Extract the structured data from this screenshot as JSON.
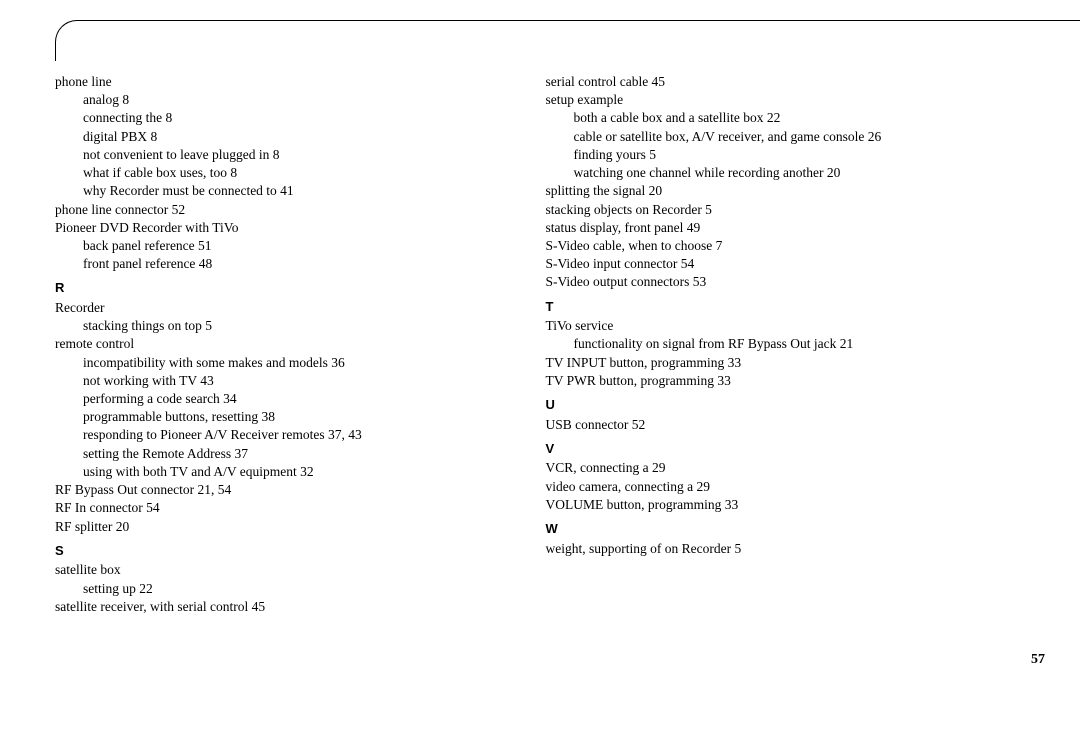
{
  "page_number": "57",
  "left_column": [
    {
      "text": "phone line",
      "indent": 0
    },
    {
      "text": "analog 8",
      "indent": 1
    },
    {
      "text": "connecting the 8",
      "indent": 1
    },
    {
      "text": "digital PBX 8",
      "indent": 1
    },
    {
      "text": "not convenient to leave plugged in 8",
      "indent": 1
    },
    {
      "text": "what if cable box uses, too 8",
      "indent": 1
    },
    {
      "text": "why Recorder must be connected to 41",
      "indent": 1
    },
    {
      "text": "phone line connector 52",
      "indent": 0
    },
    {
      "text": "Pioneer DVD Recorder with TiVo",
      "indent": 0
    },
    {
      "text": "back panel reference 51",
      "indent": 1
    },
    {
      "text": "front panel reference 48",
      "indent": 1
    },
    {
      "letter": "R"
    },
    {
      "text": "Recorder",
      "indent": 0
    },
    {
      "text": "stacking things on top 5",
      "indent": 1
    },
    {
      "text": "remote control",
      "indent": 0
    },
    {
      "text": "incompatibility with some makes and models 36",
      "indent": 1
    },
    {
      "text": "not working with TV 43",
      "indent": 1
    },
    {
      "text": "performing a code search 34",
      "indent": 1
    },
    {
      "text": "programmable buttons, resetting 38",
      "indent": 1
    },
    {
      "text": "responding to Pioneer A/V Receiver remotes 37, 43",
      "indent": 1
    },
    {
      "text": "setting the Remote Address 37",
      "indent": 1
    },
    {
      "text": "using with both TV and A/V equipment 32",
      "indent": 1
    },
    {
      "text": "RF Bypass Out connector 21, 54",
      "indent": 0
    },
    {
      "text": "RF In connector 54",
      "indent": 0
    },
    {
      "text": "RF splitter 20",
      "indent": 0
    },
    {
      "letter": "S"
    },
    {
      "text": "satellite box",
      "indent": 0
    },
    {
      "text": "setting up 22",
      "indent": 1
    },
    {
      "text": "satellite receiver, with serial control 45",
      "indent": 0
    }
  ],
  "right_column": [
    {
      "text": "serial control cable 45",
      "indent": 0
    },
    {
      "text": "setup example",
      "indent": 0
    },
    {
      "text": "both a cable box and a satellite box 22",
      "indent": 1
    },
    {
      "text": "cable or satellite box, A/V receiver, and game console 26",
      "indent": 1
    },
    {
      "text": "finding yours 5",
      "indent": 1
    },
    {
      "text": "watching one channel while recording another 20",
      "indent": 1
    },
    {
      "text": "splitting the signal 20",
      "indent": 0
    },
    {
      "text": "stacking objects on Recorder 5",
      "indent": 0
    },
    {
      "text": "status display, front panel 49",
      "indent": 0
    },
    {
      "text": "S-Video cable, when to choose 7",
      "indent": 0
    },
    {
      "text": "S-Video input connector 54",
      "indent": 0
    },
    {
      "text": "S-Video output connectors 53",
      "indent": 0
    },
    {
      "letter": "T"
    },
    {
      "text": "TiVo service",
      "indent": 0
    },
    {
      "text": "functionality on signal from RF Bypass Out jack 21",
      "indent": 1
    },
    {
      "text": "TV INPUT button, programming 33",
      "indent": 0
    },
    {
      "text": "TV PWR button, programming 33",
      "indent": 0
    },
    {
      "letter": "U"
    },
    {
      "text": "USB connector 52",
      "indent": 0
    },
    {
      "letter": "V"
    },
    {
      "text": "VCR, connecting a 29",
      "indent": 0
    },
    {
      "text": "video camera, connecting a 29",
      "indent": 0
    },
    {
      "text": "VOLUME button, programming 33",
      "indent": 0
    },
    {
      "letter": "W"
    },
    {
      "text": "weight, supporting of on Recorder 5",
      "indent": 0
    }
  ]
}
